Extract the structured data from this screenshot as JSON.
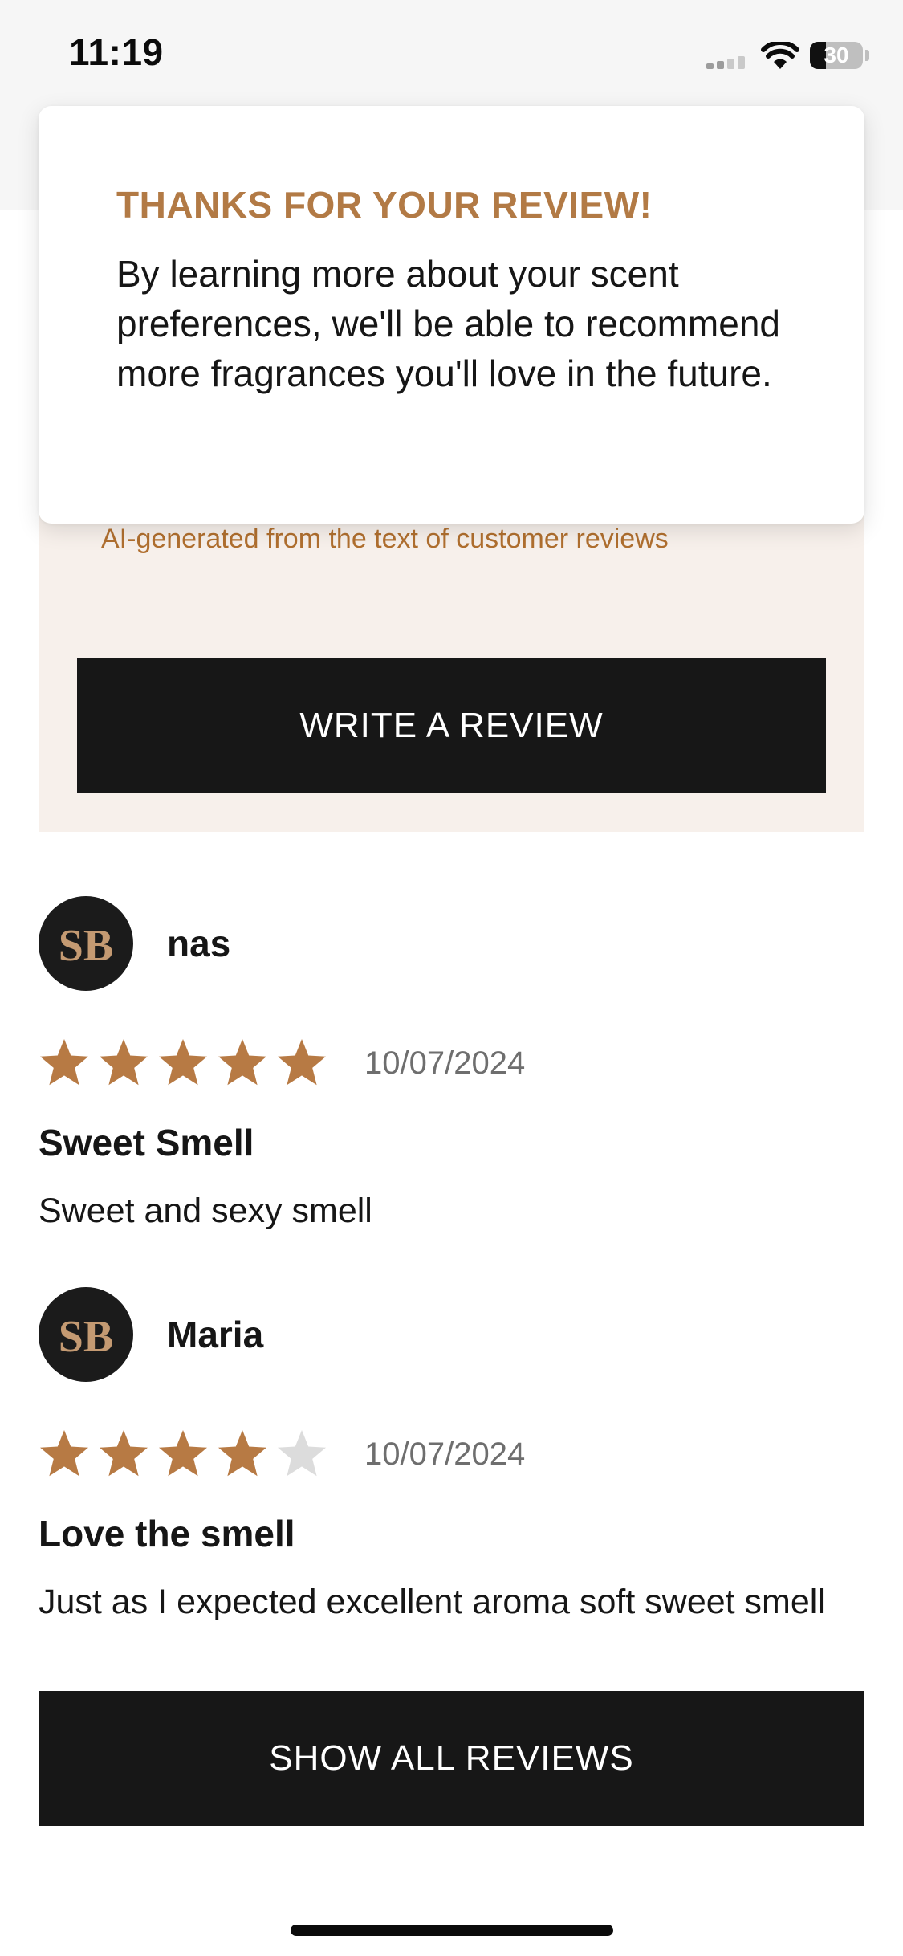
{
  "status_bar": {
    "time": "11:19",
    "battery_level": "30",
    "battery_fraction": 0.3
  },
  "toast": {
    "title": "THANKS FOR YOUR REVIEW!",
    "body": "By learning more about your scent preferences, we'll be able to recommend more fragrances you'll love in the future."
  },
  "summary": {
    "ai_note": "AI-generated from the text of customer reviews",
    "write_review_label": "WRITE A REVIEW"
  },
  "reviews": [
    {
      "name": "nas",
      "rating": 5,
      "max_rating": 5,
      "date": "10/07/2024",
      "title": "Sweet Smell",
      "text": "Sweet and sexy smell"
    },
    {
      "name": "Maria",
      "rating": 4,
      "max_rating": 5,
      "date": "10/07/2024",
      "title": "Love the smell",
      "text": "Just as I expected excellent aroma soft sweet smell"
    }
  ],
  "show_all_label": "SHOW ALL REVIEWS",
  "colors": {
    "accent": "#b27a45",
    "star_filled": "#b77a44",
    "star_empty": "#dcdcdc",
    "button_bg": "#171717",
    "panel_bg": "#f7f0eb",
    "avatar_logo": "#c49a72"
  },
  "icons": {
    "avatar_logo": "sb-monogram-logo",
    "wifi": "wifi-icon",
    "signal": "cellular-signal-icon",
    "battery": "battery-icon"
  }
}
